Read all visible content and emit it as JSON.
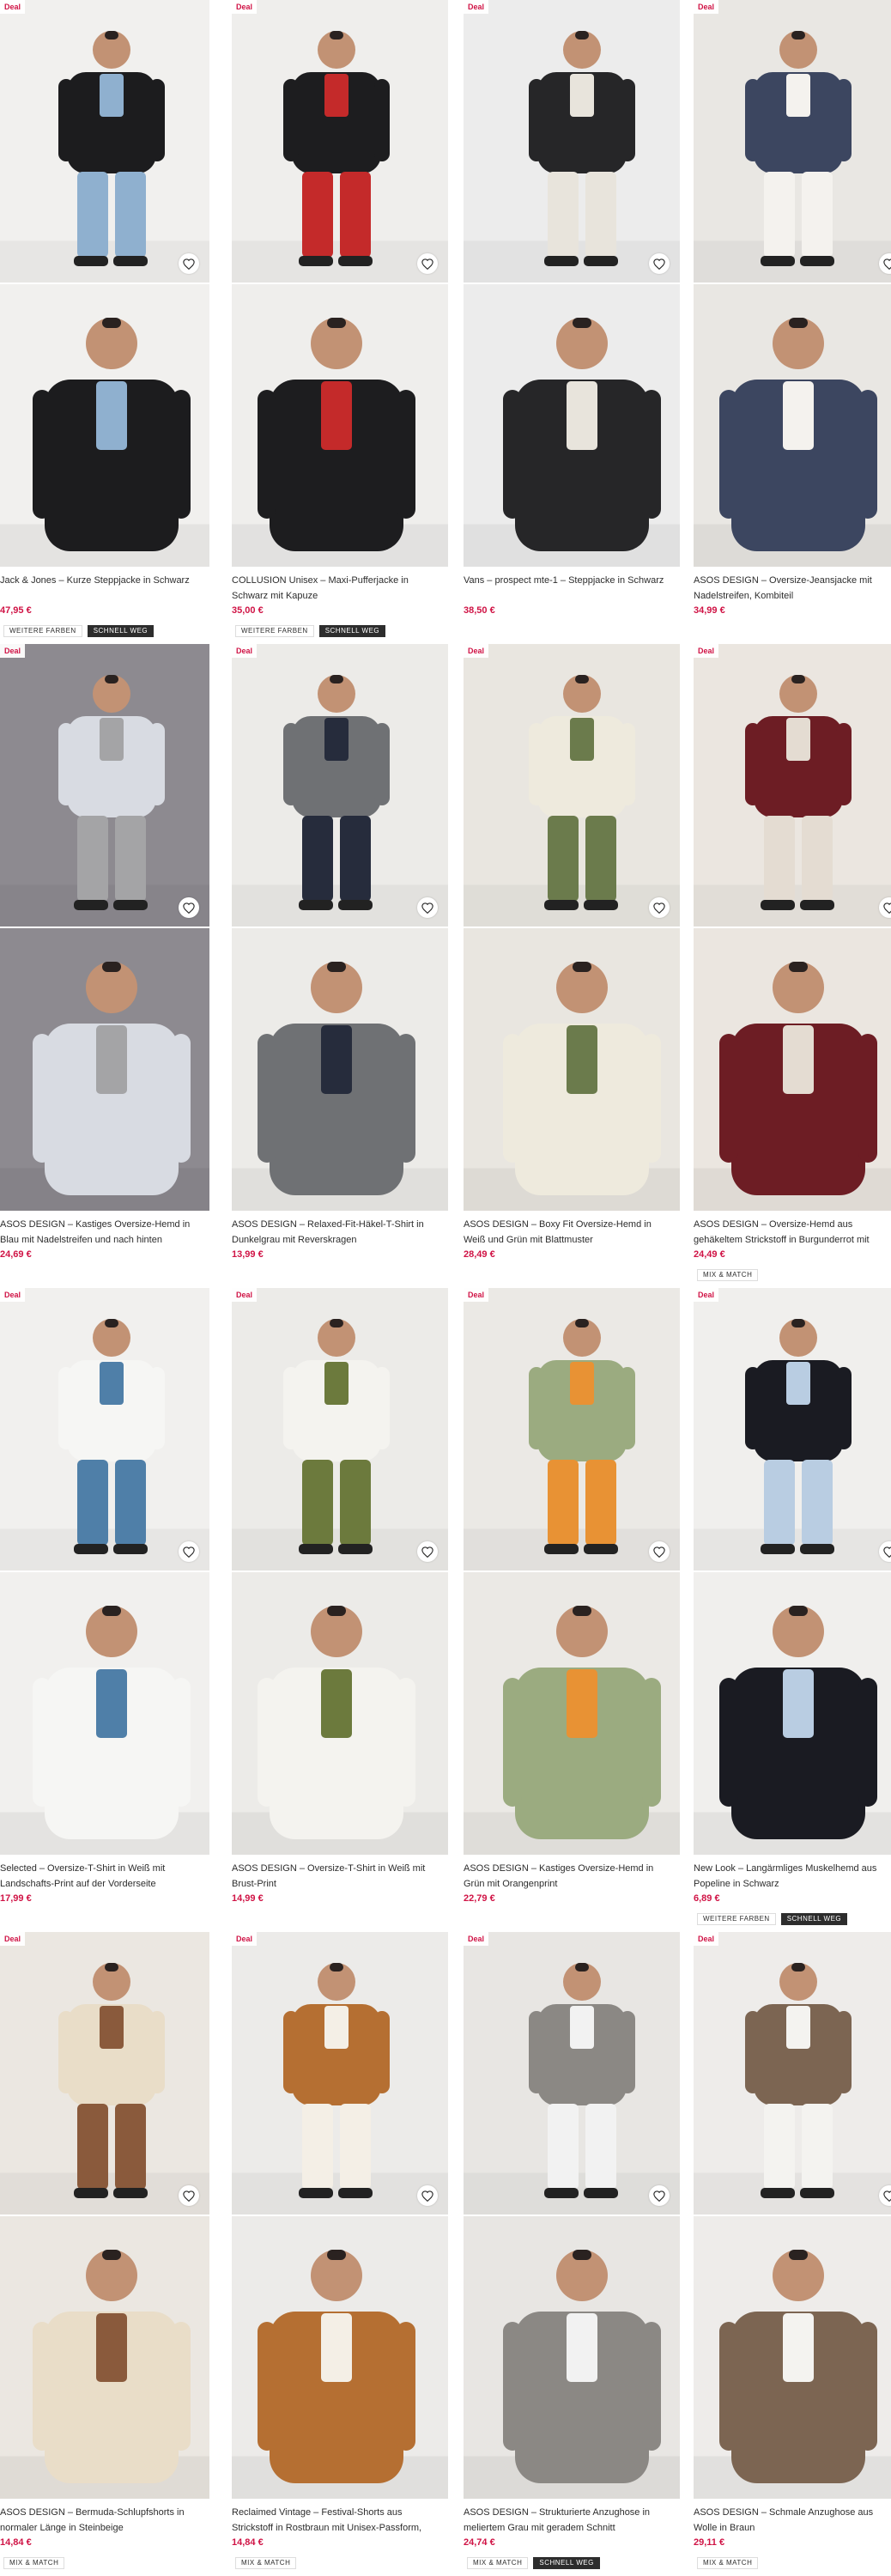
{
  "products": [
    {
      "deal": "Deal",
      "title": "Jack & Jones – Kurze Steppjacke in Schwarz",
      "price": "47,95 €",
      "badges": [
        "WEITERE FARBEN",
        "SCHNELL WEG"
      ],
      "colors": {
        "bg": "#f1f0ee",
        "main": "#1c1c1e",
        "accent": "#8fb0cf"
      }
    },
    {
      "deal": "Deal",
      "title": "COLLUSION Unisex – Maxi-Pufferjacke in Schwarz mit Kapuze",
      "price": "35,00 €",
      "badges": [
        "WEITERE FARBEN",
        "SCHNELL WEG"
      ],
      "colors": {
        "bg": "#efeeec",
        "main": "#1d1d1f",
        "accent": "#c42a2a"
      }
    },
    {
      "deal": "Deal",
      "title": "Vans – prospect mte-1 – Steppjacke in Schwarz",
      "price": "38,50 €",
      "badges": [],
      "colors": {
        "bg": "#ececec",
        "main": "#262628",
        "accent": "#e8e4dc"
      }
    },
    {
      "deal": "Deal",
      "title": "ASOS DESIGN – Oversize-Jeansjacke mit Nadelstreifen, Kombiteil",
      "price": "34,99 €",
      "badges": [],
      "colors": {
        "bg": "#e9e7e3",
        "main": "#3c4660",
        "accent": "#f4f2ee"
      }
    },
    {
      "deal": "Deal",
      "title": "ASOS DESIGN – Kastiges Oversize-Hemd in Blau mit Nadelstreifen und nach hinten abfallendem …",
      "price": "24,69 €",
      "badges": [],
      "colors": {
        "bg": "#8d8a90",
        "main": "#d8dbe2",
        "accent": "#a4a4a6"
      }
    },
    {
      "deal": "Deal",
      "title": "ASOS DESIGN – Relaxed-Fit-Häkel-T-Shirt in Dunkelgrau mit Reverskragen",
      "price": "13,99 €",
      "badges": [],
      "colors": {
        "bg": "#ecebe8",
        "main": "#6f7174",
        "accent": "#262c3c"
      }
    },
    {
      "deal": "Deal",
      "title": "ASOS DESIGN – Boxy Fit Oversize-Hemd in Weiß und Grün mit Blattmuster",
      "price": "28,49 €",
      "badges": [],
      "colors": {
        "bg": "#e9e6e0",
        "main": "#eeeadd",
        "accent": "#6b7b4c"
      }
    },
    {
      "deal": "Deal",
      "title": "ASOS DESIGN – Oversize-Hemd aus gehäkeltem Strickstoff in Burgunderrot mit halblangen Ärmeln",
      "price": "24,49 €",
      "badges": [
        "MIX & MATCH"
      ],
      "colors": {
        "bg": "#ebe6e0",
        "main": "#6d1d24",
        "accent": "#e4dcd2"
      }
    },
    {
      "deal": "Deal",
      "title": "Selected – Oversize-T-Shirt in Weiß mit Landschafts-Print auf der Vorderseite",
      "price": "17,99 €",
      "badges": [],
      "colors": {
        "bg": "#f1f0ee",
        "main": "#f6f6f4",
        "accent": "#4f7fa8"
      }
    },
    {
      "deal": "Deal",
      "title": "ASOS DESIGN – Oversize-T-Shirt in Weiß mit Brust-Print",
      "price": "14,99 €",
      "badges": [],
      "colors": {
        "bg": "#ecebe8",
        "main": "#f4f3ef",
        "accent": "#6c7a3d"
      }
    },
    {
      "deal": "Deal",
      "title": "ASOS DESIGN – Kastiges Oversize-Hemd in Grün mit Orangenprint",
      "price": "22,79 €",
      "badges": [],
      "colors": {
        "bg": "#ebe9e5",
        "main": "#9bab80",
        "accent": "#e89234"
      }
    },
    {
      "deal": "Deal",
      "title": "New Look – Langärmliges Muskelhemd aus Popeline in Schwarz",
      "price": "6,89 €",
      "badges": [
        "WEITERE FARBEN",
        "SCHNELL WEG"
      ],
      "colors": {
        "bg": "#f0efed",
        "main": "#1a1b22",
        "accent": "#b9cde2"
      }
    },
    {
      "deal": "Deal",
      "title": "ASOS DESIGN – Bermuda-Schlupfshorts in normaler Länge in Steinbeige",
      "price": "14,84 €",
      "badges": [
        "MIX & MATCH"
      ],
      "colors": {
        "bg": "#ebe7e1",
        "main": "#e9ddc8",
        "accent": "#8a5a3c"
      }
    },
    {
      "deal": "Deal",
      "title": "Reclaimed Vintage – Festival-Shorts aus Strickstoff in Rostbraun mit Unisex-Passform, Kombiteil",
      "price": "14,84 €",
      "badges": [
        "MIX & MATCH"
      ],
      "colors": {
        "bg": "#ecebe9",
        "main": "#b56f32",
        "accent": "#f4efe6"
      }
    },
    {
      "deal": "Deal",
      "title": "ASOS DESIGN – Strukturierte Anzughose in meliertem Grau mit geradem Schnitt",
      "price": "24,74 €",
      "badges": [
        "MIX & MATCH",
        "SCHNELL WEG"
      ],
      "colors": {
        "bg": "#e8e6e3",
        "main": "#8b8884",
        "accent": "#f2f2f2"
      }
    },
    {
      "deal": "Deal",
      "title": "ASOS DESIGN – Schmale Anzughose aus Wolle in Braun",
      "price": "29,11 €",
      "badges": [
        "MIX & MATCH"
      ],
      "colors": {
        "bg": "#eeecea",
        "main": "#7c6552",
        "accent": "#f4f3f0"
      }
    }
  ]
}
